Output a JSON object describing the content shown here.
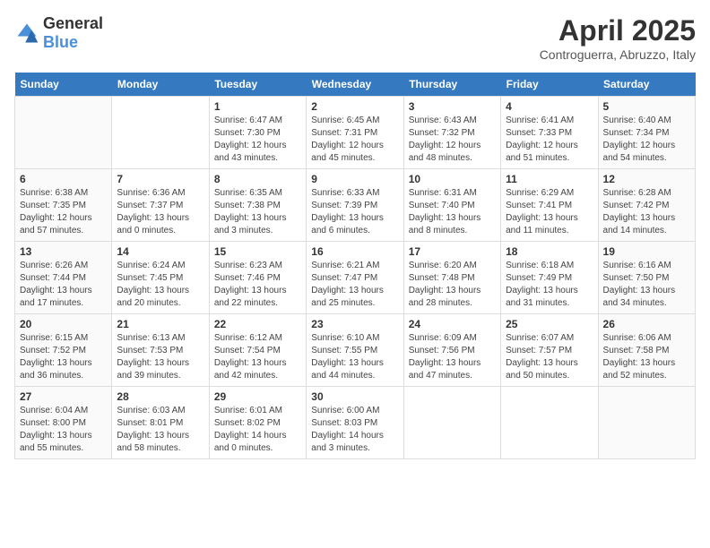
{
  "header": {
    "logo_general": "General",
    "logo_blue": "Blue",
    "month": "April 2025",
    "location": "Controguerra, Abruzzo, Italy"
  },
  "weekdays": [
    "Sunday",
    "Monday",
    "Tuesday",
    "Wednesday",
    "Thursday",
    "Friday",
    "Saturday"
  ],
  "weeks": [
    [
      {
        "day": "",
        "info": ""
      },
      {
        "day": "",
        "info": ""
      },
      {
        "day": "1",
        "info": "Sunrise: 6:47 AM\nSunset: 7:30 PM\nDaylight: 12 hours and 43 minutes."
      },
      {
        "day": "2",
        "info": "Sunrise: 6:45 AM\nSunset: 7:31 PM\nDaylight: 12 hours and 45 minutes."
      },
      {
        "day": "3",
        "info": "Sunrise: 6:43 AM\nSunset: 7:32 PM\nDaylight: 12 hours and 48 minutes."
      },
      {
        "day": "4",
        "info": "Sunrise: 6:41 AM\nSunset: 7:33 PM\nDaylight: 12 hours and 51 minutes."
      },
      {
        "day": "5",
        "info": "Sunrise: 6:40 AM\nSunset: 7:34 PM\nDaylight: 12 hours and 54 minutes."
      }
    ],
    [
      {
        "day": "6",
        "info": "Sunrise: 6:38 AM\nSunset: 7:35 PM\nDaylight: 12 hours and 57 minutes."
      },
      {
        "day": "7",
        "info": "Sunrise: 6:36 AM\nSunset: 7:37 PM\nDaylight: 13 hours and 0 minutes."
      },
      {
        "day": "8",
        "info": "Sunrise: 6:35 AM\nSunset: 7:38 PM\nDaylight: 13 hours and 3 minutes."
      },
      {
        "day": "9",
        "info": "Sunrise: 6:33 AM\nSunset: 7:39 PM\nDaylight: 13 hours and 6 minutes."
      },
      {
        "day": "10",
        "info": "Sunrise: 6:31 AM\nSunset: 7:40 PM\nDaylight: 13 hours and 8 minutes."
      },
      {
        "day": "11",
        "info": "Sunrise: 6:29 AM\nSunset: 7:41 PM\nDaylight: 13 hours and 11 minutes."
      },
      {
        "day": "12",
        "info": "Sunrise: 6:28 AM\nSunset: 7:42 PM\nDaylight: 13 hours and 14 minutes."
      }
    ],
    [
      {
        "day": "13",
        "info": "Sunrise: 6:26 AM\nSunset: 7:44 PM\nDaylight: 13 hours and 17 minutes."
      },
      {
        "day": "14",
        "info": "Sunrise: 6:24 AM\nSunset: 7:45 PM\nDaylight: 13 hours and 20 minutes."
      },
      {
        "day": "15",
        "info": "Sunrise: 6:23 AM\nSunset: 7:46 PM\nDaylight: 13 hours and 22 minutes."
      },
      {
        "day": "16",
        "info": "Sunrise: 6:21 AM\nSunset: 7:47 PM\nDaylight: 13 hours and 25 minutes."
      },
      {
        "day": "17",
        "info": "Sunrise: 6:20 AM\nSunset: 7:48 PM\nDaylight: 13 hours and 28 minutes."
      },
      {
        "day": "18",
        "info": "Sunrise: 6:18 AM\nSunset: 7:49 PM\nDaylight: 13 hours and 31 minutes."
      },
      {
        "day": "19",
        "info": "Sunrise: 6:16 AM\nSunset: 7:50 PM\nDaylight: 13 hours and 34 minutes."
      }
    ],
    [
      {
        "day": "20",
        "info": "Sunrise: 6:15 AM\nSunset: 7:52 PM\nDaylight: 13 hours and 36 minutes."
      },
      {
        "day": "21",
        "info": "Sunrise: 6:13 AM\nSunset: 7:53 PM\nDaylight: 13 hours and 39 minutes."
      },
      {
        "day": "22",
        "info": "Sunrise: 6:12 AM\nSunset: 7:54 PM\nDaylight: 13 hours and 42 minutes."
      },
      {
        "day": "23",
        "info": "Sunrise: 6:10 AM\nSunset: 7:55 PM\nDaylight: 13 hours and 44 minutes."
      },
      {
        "day": "24",
        "info": "Sunrise: 6:09 AM\nSunset: 7:56 PM\nDaylight: 13 hours and 47 minutes."
      },
      {
        "day": "25",
        "info": "Sunrise: 6:07 AM\nSunset: 7:57 PM\nDaylight: 13 hours and 50 minutes."
      },
      {
        "day": "26",
        "info": "Sunrise: 6:06 AM\nSunset: 7:58 PM\nDaylight: 13 hours and 52 minutes."
      }
    ],
    [
      {
        "day": "27",
        "info": "Sunrise: 6:04 AM\nSunset: 8:00 PM\nDaylight: 13 hours and 55 minutes."
      },
      {
        "day": "28",
        "info": "Sunrise: 6:03 AM\nSunset: 8:01 PM\nDaylight: 13 hours and 58 minutes."
      },
      {
        "day": "29",
        "info": "Sunrise: 6:01 AM\nSunset: 8:02 PM\nDaylight: 14 hours and 0 minutes."
      },
      {
        "day": "30",
        "info": "Sunrise: 6:00 AM\nSunset: 8:03 PM\nDaylight: 14 hours and 3 minutes."
      },
      {
        "day": "",
        "info": ""
      },
      {
        "day": "",
        "info": ""
      },
      {
        "day": "",
        "info": ""
      }
    ]
  ]
}
